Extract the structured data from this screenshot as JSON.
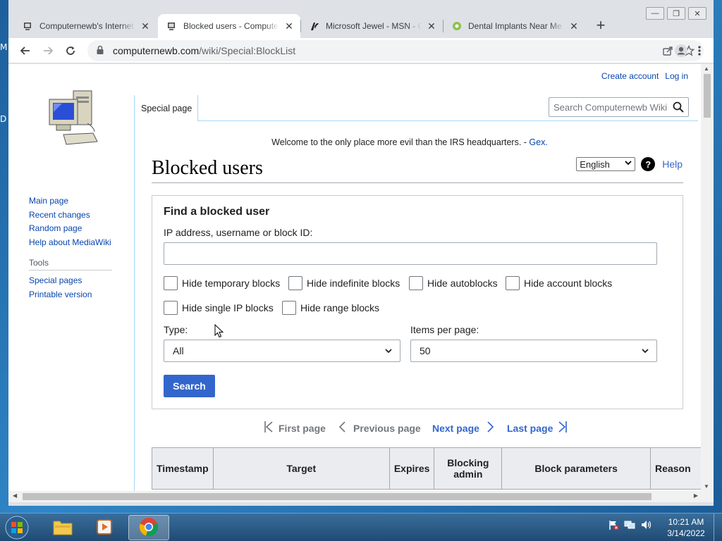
{
  "desktop": {
    "fragment_top": "M",
    "fragment_mid": "D"
  },
  "window_controls": {
    "minimize": "—",
    "maximize": "❐",
    "close": "✕"
  },
  "tabs": [
    {
      "title": "Computernewb's Internet",
      "close": "✕",
      "active": false,
      "icon": "computer-favicon-icon"
    },
    {
      "title": "Blocked users - Computernewb Wiki",
      "close": "✕",
      "active": true,
      "icon": "computer-favicon-icon"
    },
    {
      "title": "Microsoft Jewel - MSN - Games",
      "close": "✕",
      "active": false,
      "icon": "msn-favicon-icon"
    },
    {
      "title": "Dental Implants Near Me",
      "close": "✕",
      "active": false,
      "icon": "gear-favicon-icon"
    }
  ],
  "new_tab_label": "+",
  "address_bar": {
    "host": "computernewb.com",
    "path": "/wiki/Special:BlockList"
  },
  "wiki": {
    "user_tools": {
      "create_account": "Create account",
      "log_in": "Log in"
    },
    "namespace_tab": "Special page",
    "search_placeholder": "Search Computernewb Wiki",
    "sitenotice_text": "Welcome to the only place more evil than the IRS headquarters. - ",
    "sitenotice_link": "Gex.",
    "heading": "Blocked users",
    "language": "English",
    "help_label": "Help",
    "sidebar": {
      "nav": [
        "Main page",
        "Recent changes",
        "Random page",
        "Help about MediaWiki"
      ],
      "tools_heading": "Tools",
      "tools": [
        "Special pages",
        "Printable version"
      ]
    },
    "form": {
      "legend": "Find a blocked user",
      "target_label": "IP address, username or block ID:",
      "target_value": "",
      "checkboxes": [
        "Hide temporary blocks",
        "Hide indefinite blocks",
        "Hide autoblocks",
        "Hide account blocks",
        "Hide single IP blocks",
        "Hide range blocks"
      ],
      "type_label": "Type:",
      "type_value": "All",
      "limit_label": "Items per page:",
      "limit_value": "50",
      "search_button": "Search"
    },
    "pager": {
      "first": "First page",
      "previous": "Previous page",
      "next": "Next page",
      "last": "Last page"
    },
    "table_headers": [
      "Timestamp",
      "Target",
      "Expires",
      "Blocking admin",
      "Block parameters",
      "Reason"
    ]
  },
  "taskbar": {
    "time": "10:21 AM",
    "date": "3/14/2022"
  },
  "colors": {
    "link": "#0645ad",
    "progressive": "#3366cc",
    "desktop": "#2b6ea8"
  }
}
